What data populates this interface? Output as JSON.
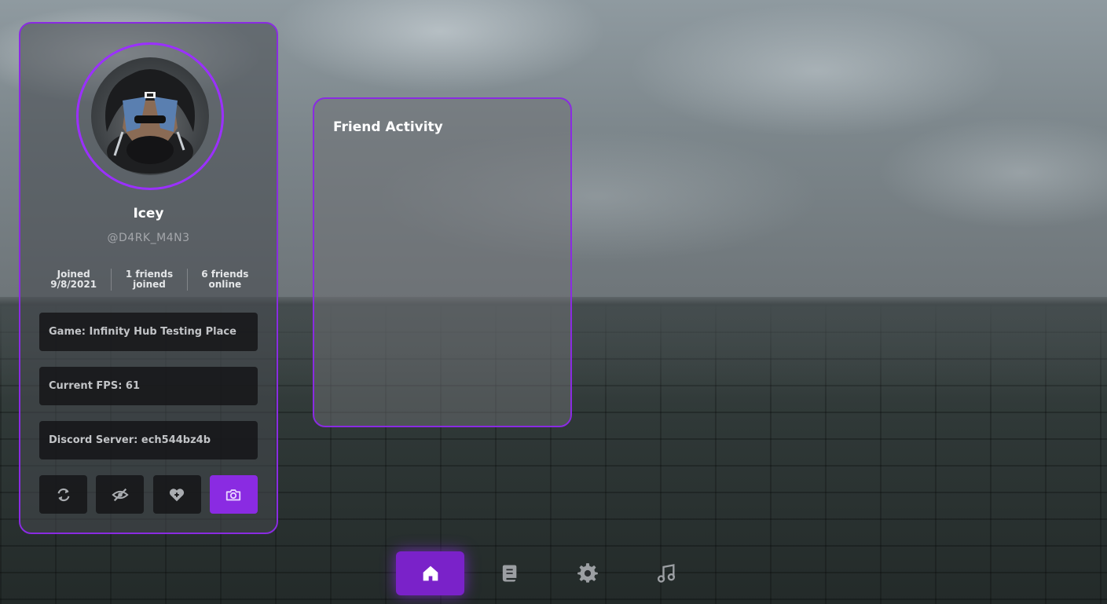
{
  "profile": {
    "display_name": "Icey",
    "username": "@D4RK_M4N3",
    "stats": [
      {
        "line1": "Joined",
        "line2": "9/8/2021"
      },
      {
        "line1": "1 friends",
        "line2": "joined"
      },
      {
        "line1": "6 friends",
        "line2": "online"
      }
    ],
    "info": {
      "game": "Game: Infinity Hub Testing Place",
      "fps": "Current FPS: 61",
      "discord": "Discord Server: ech544bz4b"
    },
    "buttons": [
      {
        "icon": "refresh-icon"
      },
      {
        "icon": "eye-off-icon"
      },
      {
        "icon": "heart-plus-icon"
      },
      {
        "icon": "camera-icon",
        "active": true
      }
    ]
  },
  "friend_activity": {
    "title": "Friend Activity"
  },
  "nav": {
    "items": [
      {
        "icon": "home-icon",
        "active": true
      },
      {
        "icon": "scroll-icon"
      },
      {
        "icon": "gear-icon"
      },
      {
        "icon": "music-note-icon"
      }
    ]
  },
  "colors": {
    "accent": "#8a2be2",
    "accent_bright": "#9b30ff",
    "panel_dark": "#141416"
  }
}
